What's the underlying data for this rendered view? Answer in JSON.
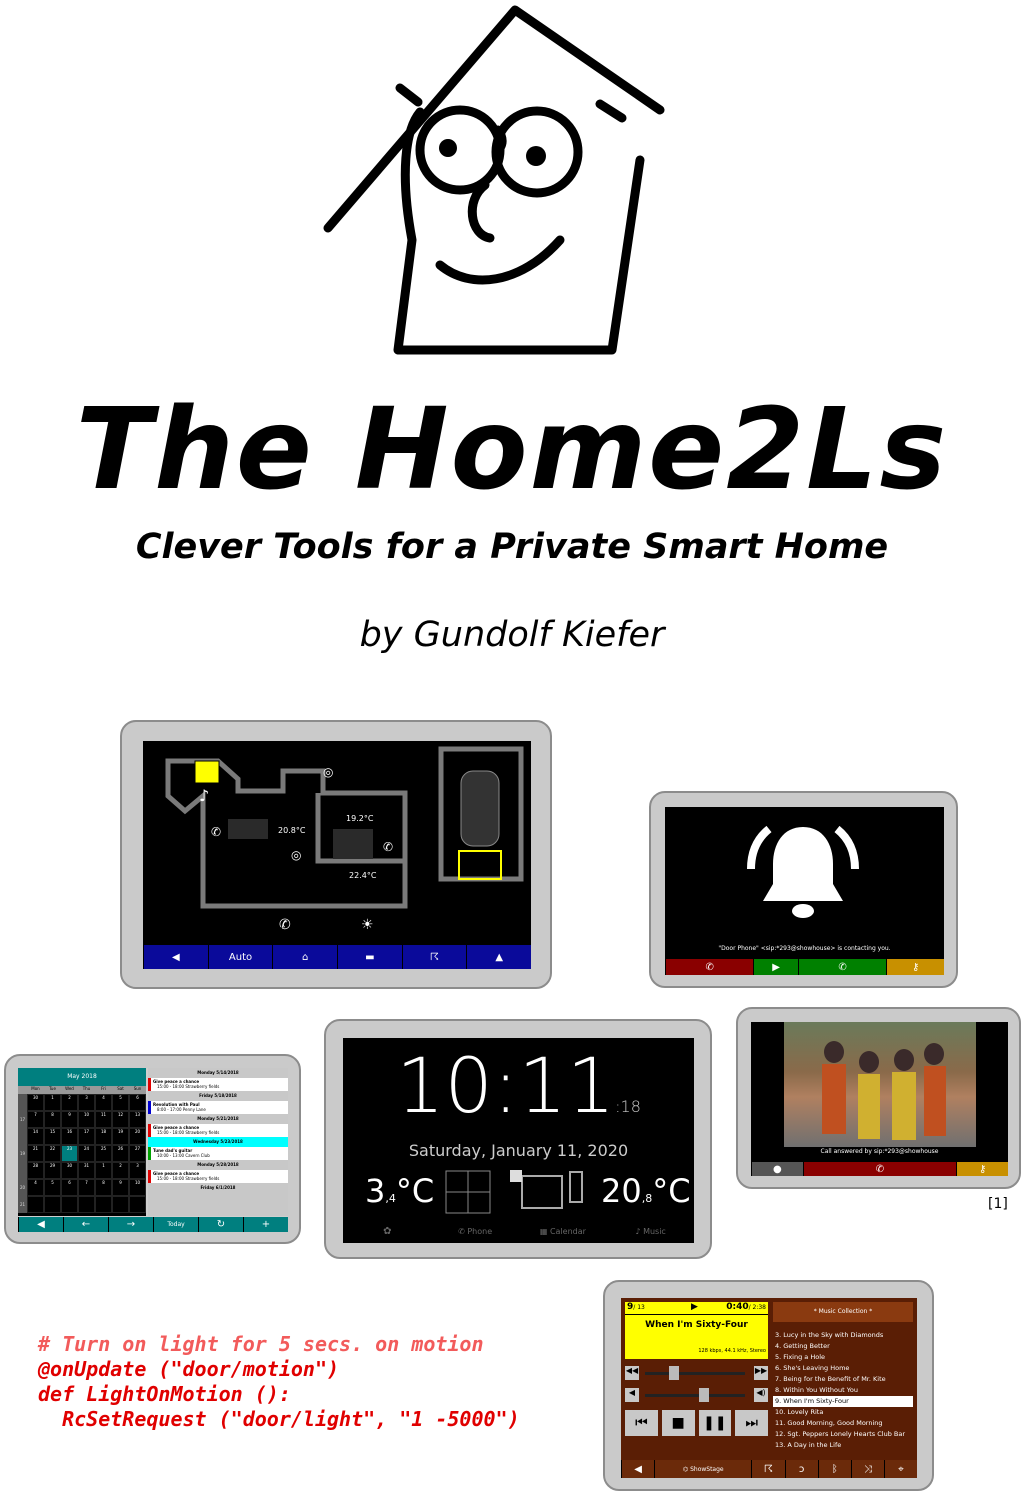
{
  "title": "The Home2Ls",
  "subtitle": "Clever Tools for a Private Smart Home",
  "author": "by Gundolf Kiefer",
  "footnote": "[1]",
  "floorplan": {
    "temps": [
      "20.8°C",
      "19.2°C",
      "22.4°C"
    ],
    "nav": [
      "◀",
      "Auto",
      "home-icon",
      "bed-icon",
      "walk-icon",
      "mountain-icon"
    ]
  },
  "doorbell": {
    "message": "\"Door Phone\" <sip:*293@showhouse> is contacting you."
  },
  "calendar": {
    "month": "May 2018",
    "weekdays": [
      "Mon",
      "Tue",
      "Wed",
      "Thu",
      "Fri",
      "Sat",
      "Sun"
    ],
    "weeks": [
      {
        "wk": "",
        "days": [
          "30",
          "1",
          "2",
          "3",
          "4",
          "5",
          "6"
        ]
      },
      {
        "wk": "17",
        "days": [
          "7",
          "8",
          "9",
          "10",
          "11",
          "12",
          "13"
        ]
      },
      {
        "wk": "",
        "days": [
          "14",
          "15",
          "16",
          "17",
          "18",
          "19",
          "20"
        ]
      },
      {
        "wk": "19",
        "days": [
          "21",
          "22",
          "23",
          "24",
          "25",
          "26",
          "27"
        ]
      },
      {
        "wk": "",
        "days": [
          "28",
          "29",
          "30",
          "31",
          "1",
          "2",
          "3"
        ]
      },
      {
        "wk": "20",
        "days": [
          "4",
          "5",
          "6",
          "7",
          "8",
          "9",
          "10"
        ]
      },
      {
        "wk": "21",
        "days": [
          "",
          "",
          "",
          "",
          "",
          "",
          ""
        ]
      }
    ],
    "agenda": [
      {
        "type": "day",
        "text": "Monday   5/14/2018"
      },
      {
        "type": "event",
        "title": "Give peace a chance",
        "detail": "15:00 - 18:00   Strawberry fields",
        "color": "#e00000"
      },
      {
        "type": "day",
        "text": "Friday   5/18/2018"
      },
      {
        "type": "event",
        "title": "Revolution with Paul",
        "detail": "8:00 - 17:00   Penny Lane",
        "color": "#0000d0"
      },
      {
        "type": "day",
        "text": "Monday   5/21/2018"
      },
      {
        "type": "event",
        "title": "Give peace a chance",
        "detail": "15:00 - 18:00   Strawberry fields",
        "color": "#e00000"
      },
      {
        "type": "today",
        "text": "Wednesday   5/23/2018"
      },
      {
        "type": "event",
        "title": "Tune dad's guitar",
        "detail": "10:00 - 13:00   Cavern Club",
        "color": "#00a000"
      },
      {
        "type": "day",
        "text": "Monday   5/28/2018"
      },
      {
        "type": "event",
        "title": "Give peace a chance",
        "detail": "15:00 - 18:00   Strawberry fields",
        "color": "#e00000"
      },
      {
        "type": "day",
        "text": "Friday   6/1/2018"
      }
    ],
    "nav": [
      "◀",
      "←",
      "→",
      "Today",
      "↻",
      "+"
    ]
  },
  "clock": {
    "time": "10:11",
    "seconds": ":18",
    "date": "Saturday, January 11, 2020",
    "temp_out": "3",
    "temp_out_dec": ",4",
    "temp_in": "20",
    "temp_in_dec": ",8",
    "unit": "°C",
    "nav": [
      "Phone",
      "Calendar",
      "Music"
    ]
  },
  "videocall": {
    "message": "Call answered by sip:*293@showhouse"
  },
  "music": {
    "track_no": "9",
    "track_total": "/ 13",
    "elapsed": "0:40",
    "duration": "/ 2:38",
    "song": "When I'm Sixty-Four",
    "info": "128 kbps, 44.1 kHz, Stereo",
    "collection": "* Music Collection *",
    "playlist": [
      "3. Lucy in the Sky with Diamonds",
      "4. Getting Better",
      "5. Fixing a Hole",
      "6. She's Leaving Home",
      "7. Being for the Benefit of Mr. Kite",
      "8. Within You Without You",
      "9. When I'm Sixty-Four",
      "10. Lovely Rita",
      "11. Good Morning, Good Morning",
      "12. Sgt. Peppers Lonely Hearts Club Bar",
      "13. A Day in the Life"
    ],
    "selected_index": 6,
    "stage": "ShowStage"
  },
  "code": {
    "comment": "# Turn on light for 5 secs. on motion",
    "line1": "@onUpdate (\"door/motion\")",
    "line2": "def LightOnMotion ():",
    "line3": "  RcSetRequest (\"door/light\", \"1 -5000\")"
  },
  "colors": {
    "tablet_frame": "#cacaca",
    "floorplan_nav": "#0a0a9a",
    "calendar_accent": "#007f7f",
    "today_highlight": "#00ffff",
    "code_red": "#e00000",
    "music_yellow": "#ffff00",
    "music_brown": "#6b2a0a"
  }
}
